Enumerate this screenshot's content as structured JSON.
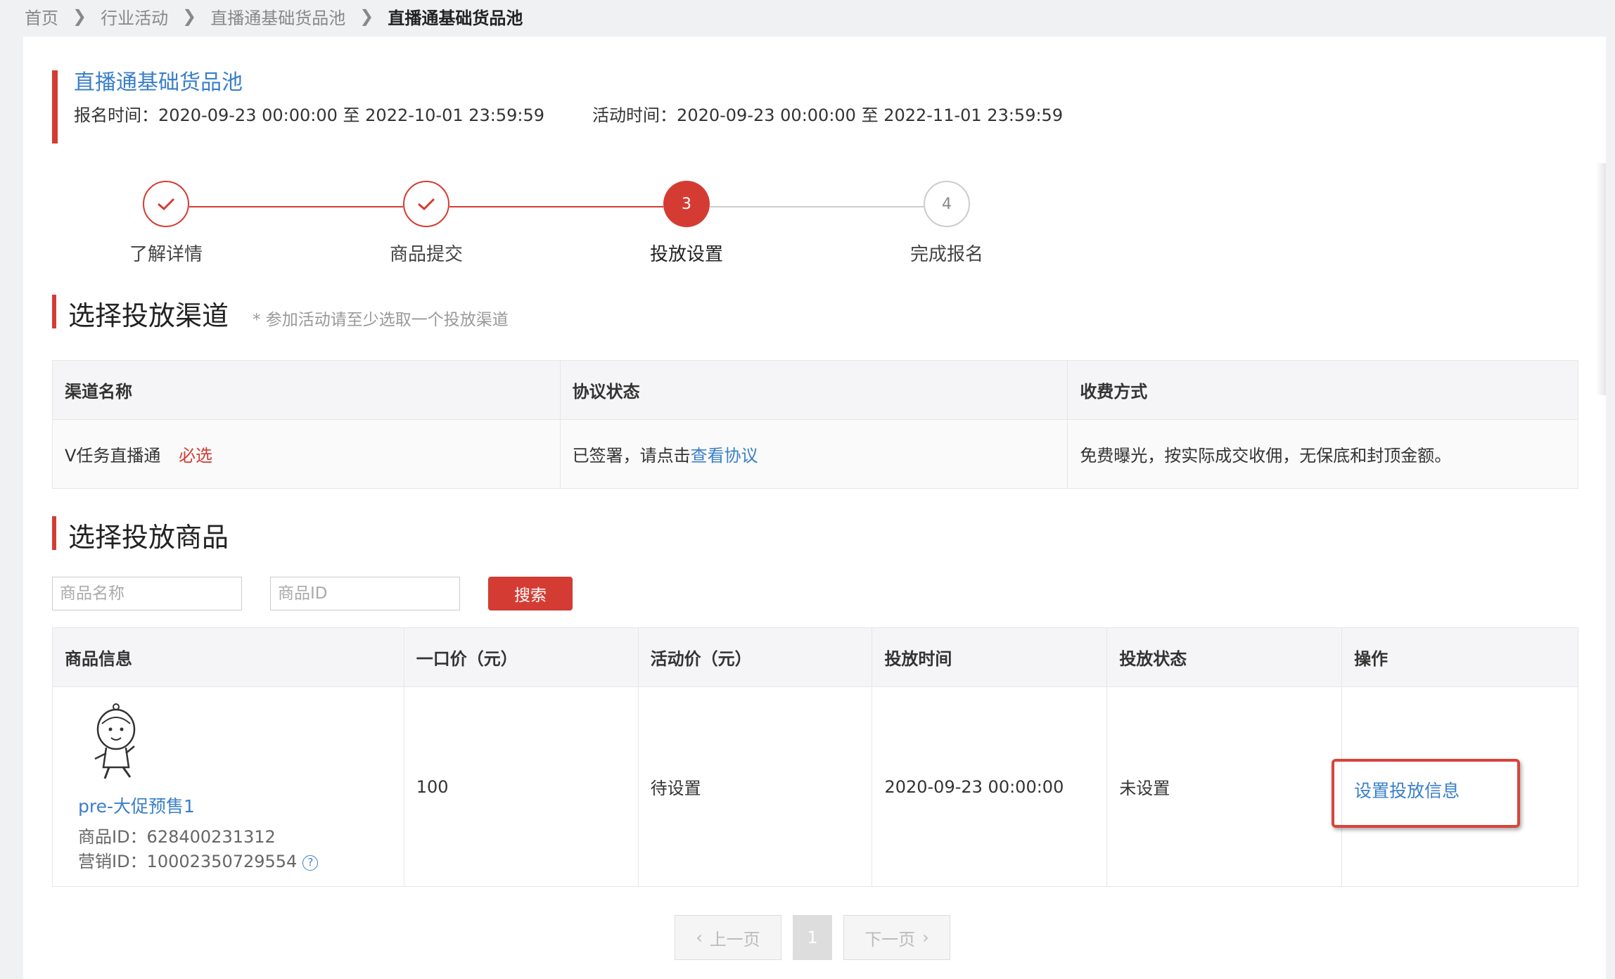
{
  "breadcrumb": {
    "items": [
      "首页",
      "行业活动",
      "直播通基础货品池"
    ],
    "current": "直播通基础货品池"
  },
  "header": {
    "title": "直播通基础货品池",
    "signup_time": "报名时间：2020-09-23 00:00:00 至 2022-10-01 23:59:59",
    "activity_time": "活动时间：2020-09-23 00:00:00 至 2022-11-01 23:59:59"
  },
  "steps": [
    {
      "number": "1",
      "label": "了解详情",
      "status": "done"
    },
    {
      "number": "2",
      "label": "商品提交",
      "status": "done"
    },
    {
      "number": "3",
      "label": "投放设置",
      "status": "active"
    },
    {
      "number": "4",
      "label": "完成报名",
      "status": "pending"
    }
  ],
  "channel_section": {
    "title": "选择投放渠道",
    "hint": "* 参加活动请至少选取一个投放渠道",
    "columns": [
      "渠道名称",
      "协议状态",
      "收费方式"
    ],
    "row": {
      "name": "V任务直播通",
      "required": "必选",
      "agreement_text": "已签署，请点击",
      "agreement_link": "查看协议",
      "fee": "免费曝光，按实际成交收佣，无保底和封顶金额。"
    }
  },
  "goods_section": {
    "title": "选择投放商品",
    "search": {
      "name_placeholder": "商品名称",
      "id_placeholder": "商品ID",
      "button": "搜索"
    },
    "columns": [
      "商品信息",
      "一口价（元）",
      "活动价（元）",
      "投放时间",
      "投放状态",
      "操作"
    ],
    "row": {
      "product_name": "pre-大促预售1",
      "product_id": "商品ID：628400231312",
      "marketing_id": "营销ID：10002350729554",
      "price": "100",
      "activity_price": "待设置",
      "time": "2020-09-23 00:00:00",
      "status": "未设置",
      "action": "设置投放信息"
    }
  },
  "pagination": {
    "prev": "上一页",
    "current": "1",
    "next": "下一页"
  },
  "colors": {
    "accent": "#d43c33",
    "link": "#3a7fc8"
  }
}
